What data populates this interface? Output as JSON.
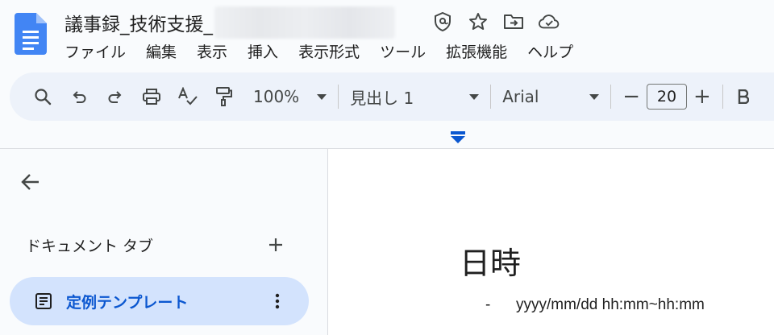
{
  "header": {
    "title": "議事録_技術支援_",
    "icons": [
      "shield-check-icon",
      "star-icon",
      "move-to-folder-icon",
      "cloud-saved-icon"
    ]
  },
  "menu": [
    "ファイル",
    "編集",
    "表示",
    "挿入",
    "表示形式",
    "ツール",
    "拡張機能",
    "ヘルプ"
  ],
  "toolbar": {
    "zoom": "100%",
    "style": "見出し 1",
    "font": "Arial",
    "font_size": "20",
    "minus": "−",
    "plus": "+"
  },
  "sidebar": {
    "tabs_header": "ドキュメント タブ",
    "active_tab": "定例テンプレート"
  },
  "document": {
    "heading": "日時",
    "bullet_marker": "-",
    "bullet_text": "yyyy/mm/dd hh:mm~hh:mm"
  },
  "colors": {
    "accent": "#0b57d0",
    "docs_blue": "#4285f4",
    "toolbar_bg": "#edf2fa",
    "active_tab_bg": "#d3e3fd"
  }
}
